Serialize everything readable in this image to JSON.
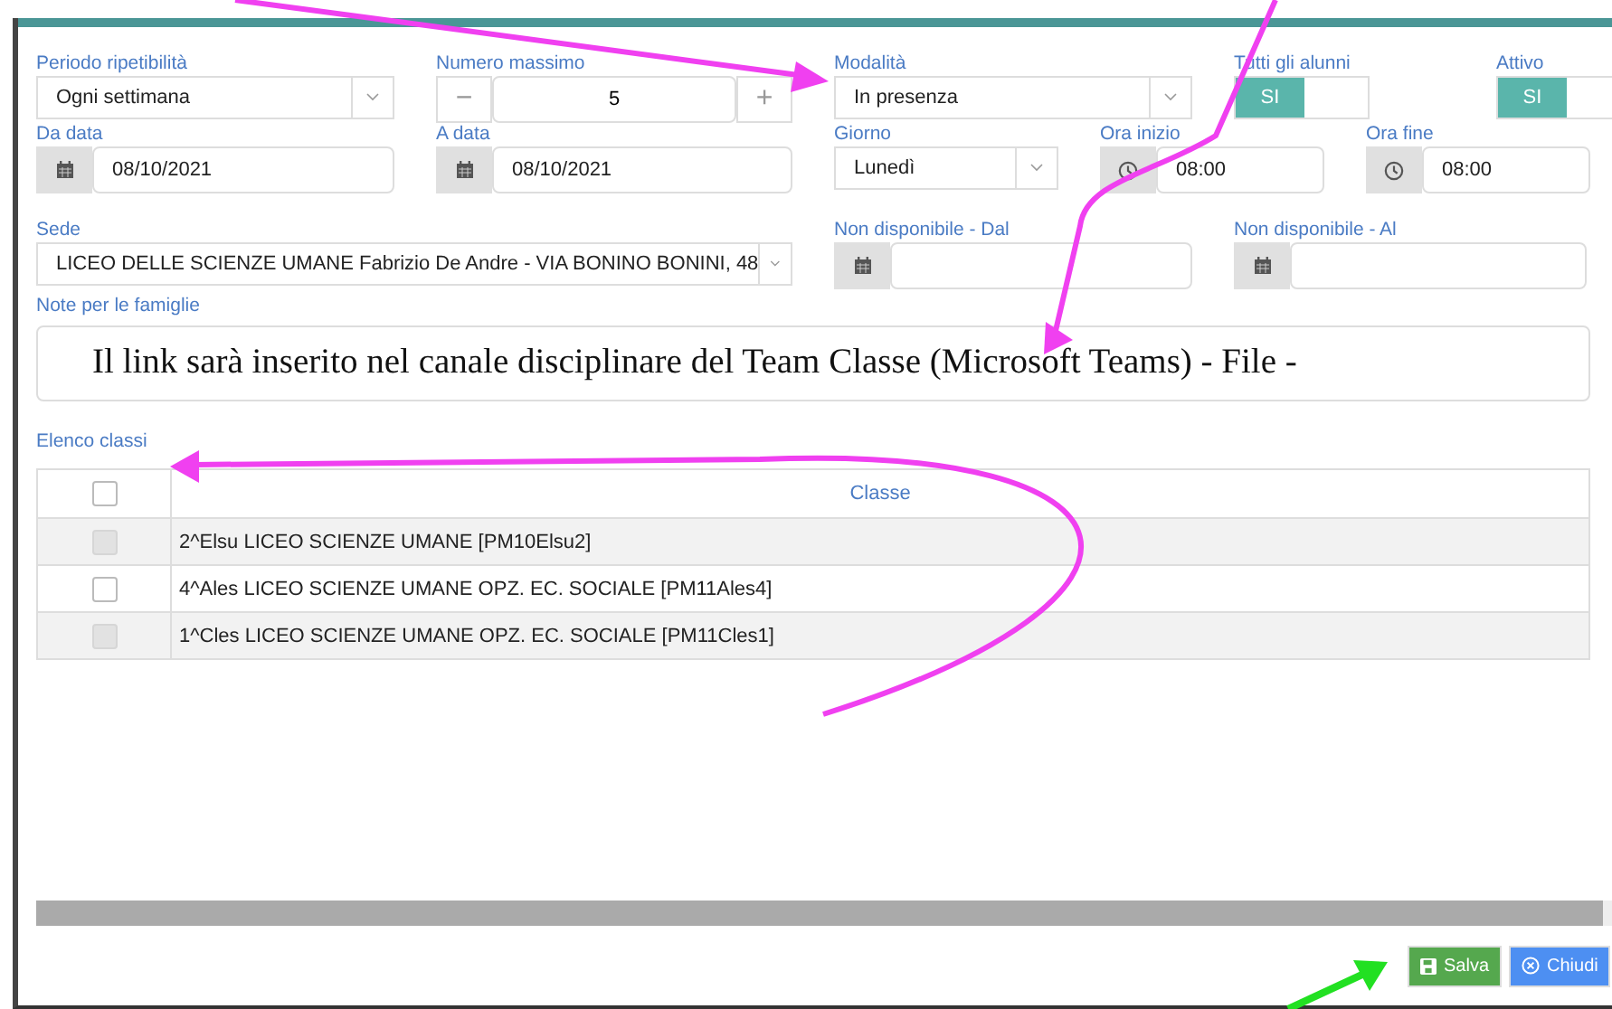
{
  "form": {
    "periodo": {
      "label": "Periodo ripetibilità",
      "value": "Ogni settimana"
    },
    "numero_massimo": {
      "label": "Numero massimo",
      "value": "5",
      "minus": "−",
      "plus": "+"
    },
    "modalita": {
      "label": "Modalità",
      "value": "In presenza"
    },
    "toggles": [
      {
        "label": "Tutti gli alunni",
        "on_label": "SI",
        "on": true
      },
      {
        "label": "Attivo",
        "on_label": "SI",
        "on": true
      }
    ],
    "da_data": {
      "label": "Da data",
      "value": "08/10/2021"
    },
    "a_data": {
      "label": "A data",
      "value": "08/10/2021"
    },
    "giorno": {
      "label": "Giorno",
      "value": "Lunedì"
    },
    "ora_inizio": {
      "label": "Ora inizio",
      "value": "08:00"
    },
    "ora_fine": {
      "label": "Ora fine",
      "value": "08:00"
    },
    "sede": {
      "label": "Sede",
      "value": "LICEO DELLE SCIENZE UMANE Fabrizio De Andre - VIA BONINO BONINI, 48"
    },
    "non_disp_dal": {
      "label": "Non disponibile - Dal"
    },
    "non_disp_al": {
      "label": "Non disponibile - Al"
    },
    "note": {
      "label": "Note per le famiglie",
      "value": "Il link sarà inserito nel canale disciplinare del Team Classe (Microsoft Teams) - File -"
    }
  },
  "classes": {
    "label": "Elenco classi",
    "header_checked": false,
    "column": "Classe",
    "rows": [
      {
        "name": "2^Elsu LICEO SCIENZE UMANE [PM10Elsu2]",
        "checked": false,
        "disabled": true
      },
      {
        "name": "4^Ales LICEO SCIENZE UMANE OPZ. EC. SOCIALE [PM11Ales4]",
        "checked": false,
        "disabled": false
      },
      {
        "name": "1^Cles LICEO SCIENZE UMANE OPZ. EC. SOCIALE [PM11Cles1]",
        "checked": false,
        "disabled": true
      }
    ]
  },
  "footer": {
    "buttons": [
      {
        "label": "Salva",
        "kind": "save"
      },
      {
        "label": "Chiudi",
        "kind": "close"
      }
    ]
  }
}
